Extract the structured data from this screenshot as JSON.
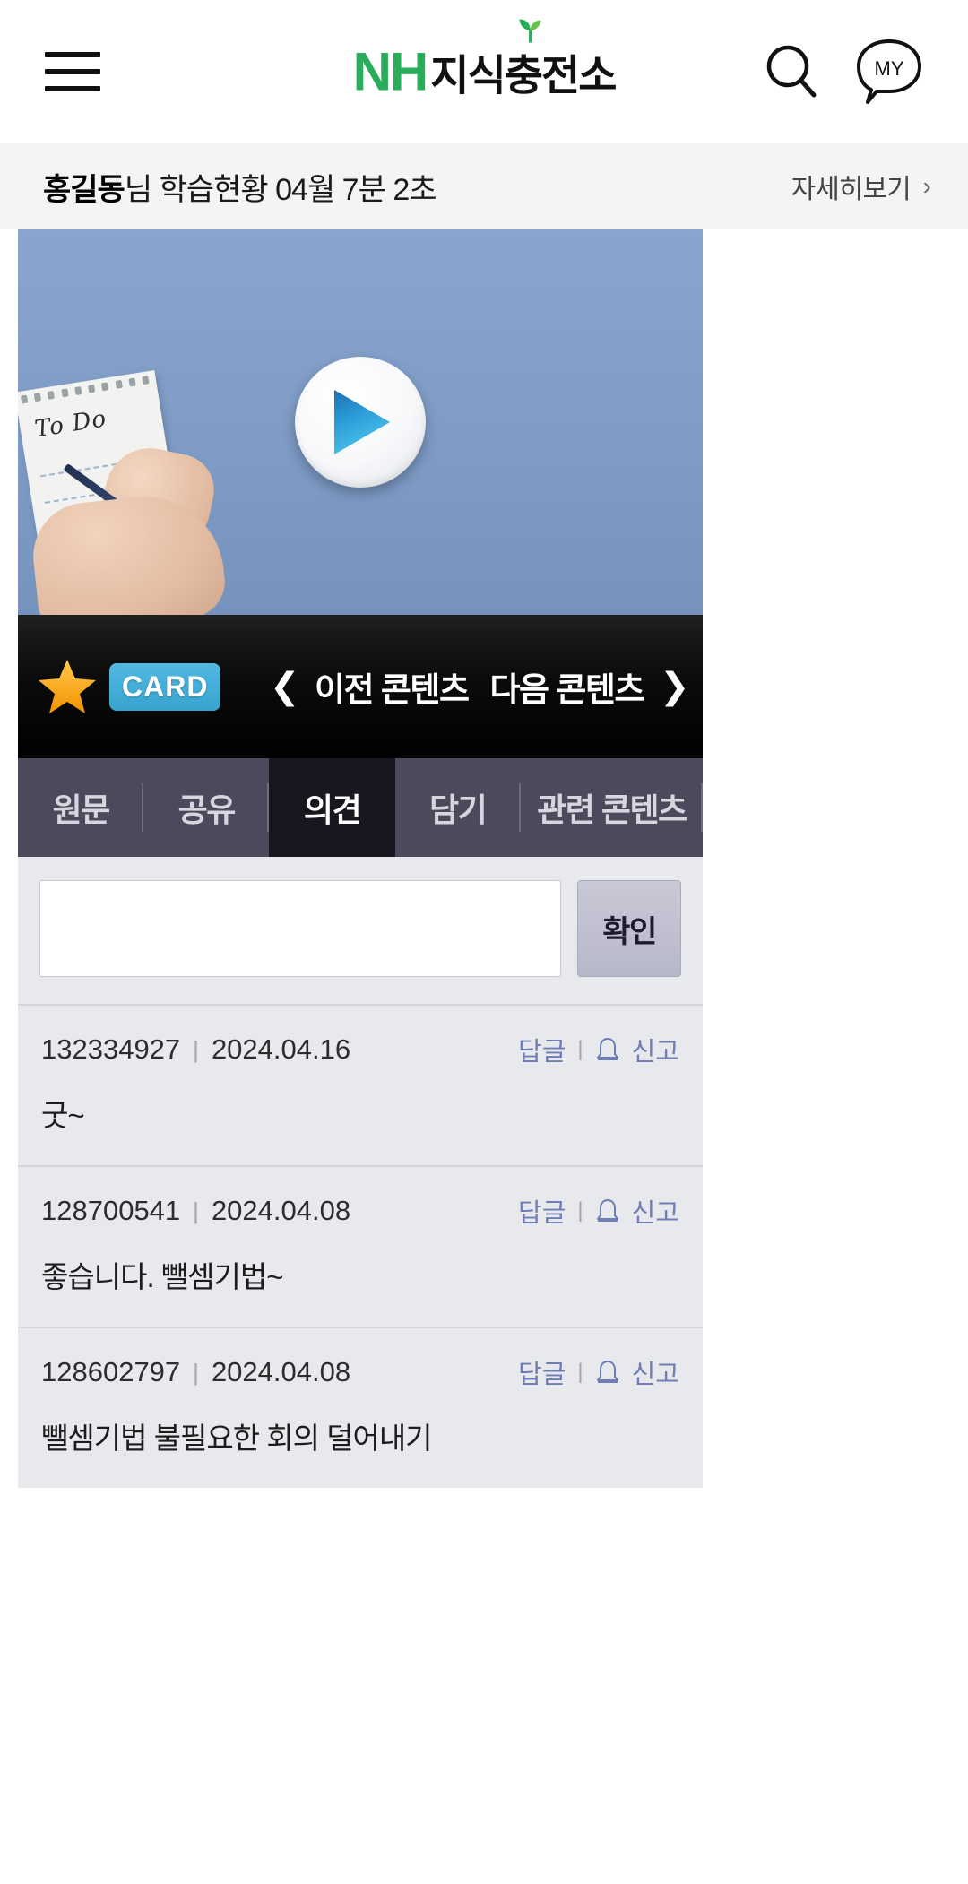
{
  "header": {
    "menu_icon": "hamburger-icon",
    "logo_mark": "NH",
    "logo_text": "지식충전소",
    "search_icon": "search-icon",
    "my_icon": "my-icon",
    "my_label": "MY"
  },
  "status": {
    "user_name": "홍길동",
    "suffix": "님 학습현황 04월 7분 2초",
    "more_label": "자세히보기",
    "more_chevron": "›"
  },
  "player": {
    "thumbnail_note_text": "To Do",
    "play_icon": "play-icon",
    "background_color": "#7f9cc6"
  },
  "controls": {
    "star_icon": "star-icon",
    "card_badge": "CARD",
    "prev_chevron": "❮",
    "prev_label": "이전 콘텐츠",
    "next_label": "다음 콘텐츠",
    "next_chevron": "❯"
  },
  "tabs": [
    {
      "label": "원문",
      "active": false
    },
    {
      "label": "공유",
      "active": false
    },
    {
      "label": "의견",
      "active": true
    },
    {
      "label": "담기",
      "active": false
    },
    {
      "label": "관련 콘텐츠",
      "active": false
    }
  ],
  "comment_form": {
    "value": "",
    "placeholder": "",
    "submit_label": "확인"
  },
  "comments": [
    {
      "user_id": "132334927",
      "separator": "|",
      "date": "2024.04.16",
      "reply_label": "답글",
      "report_label": "신고",
      "report_icon": "bell-icon",
      "text": "굿~"
    },
    {
      "user_id": "128700541",
      "separator": "|",
      "date": "2024.04.08",
      "reply_label": "답글",
      "report_label": "신고",
      "report_icon": "bell-icon",
      "text": "좋습니다. 뺄셈기법~"
    },
    {
      "user_id": "128602797",
      "separator": "|",
      "date": "2024.04.08",
      "reply_label": "답글",
      "report_label": "신고",
      "report_icon": "bell-icon",
      "text": "뺄셈기법 불필요한 회의 덜어내기"
    }
  ],
  "colors": {
    "brand_green": "#2aad5a",
    "card_blue": "#37a4cf",
    "star_orange": "#f5a623",
    "tab_bar": "#4a4a5c",
    "tab_active": "#17171f",
    "link_blue": "#6f7fb5"
  }
}
